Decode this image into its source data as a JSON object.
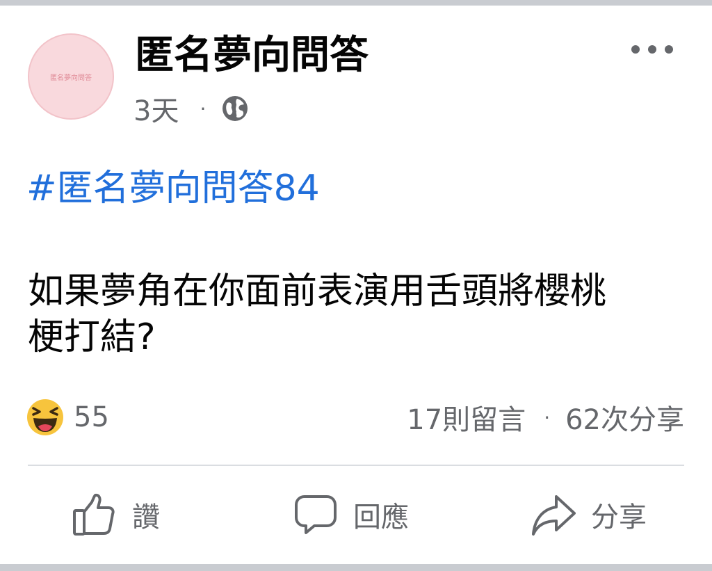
{
  "post": {
    "avatar_text": "匿名夢向問答",
    "page_name": "匿名夢向問答",
    "time": "3天",
    "dot": "·",
    "hashtag": "#匿名夢向問答84",
    "body_lines": [
      "如果夢角在你面前表演用舌頭將櫻桃",
      "梗打結?"
    ],
    "reaction_icon": "haha-emoji-icon",
    "reaction_count": "55",
    "comments": "17則留言",
    "shares": "62次分享",
    "privacy_icon": "globe-icon"
  },
  "actions": {
    "like_label": "讚",
    "comment_label": "回應",
    "share_label": "分享"
  },
  "colors": {
    "link": "#216fdb",
    "secondary_text": "#65676b",
    "avatar_bg": "#f9d9dd",
    "haha_yellow": "#f7c43d"
  }
}
